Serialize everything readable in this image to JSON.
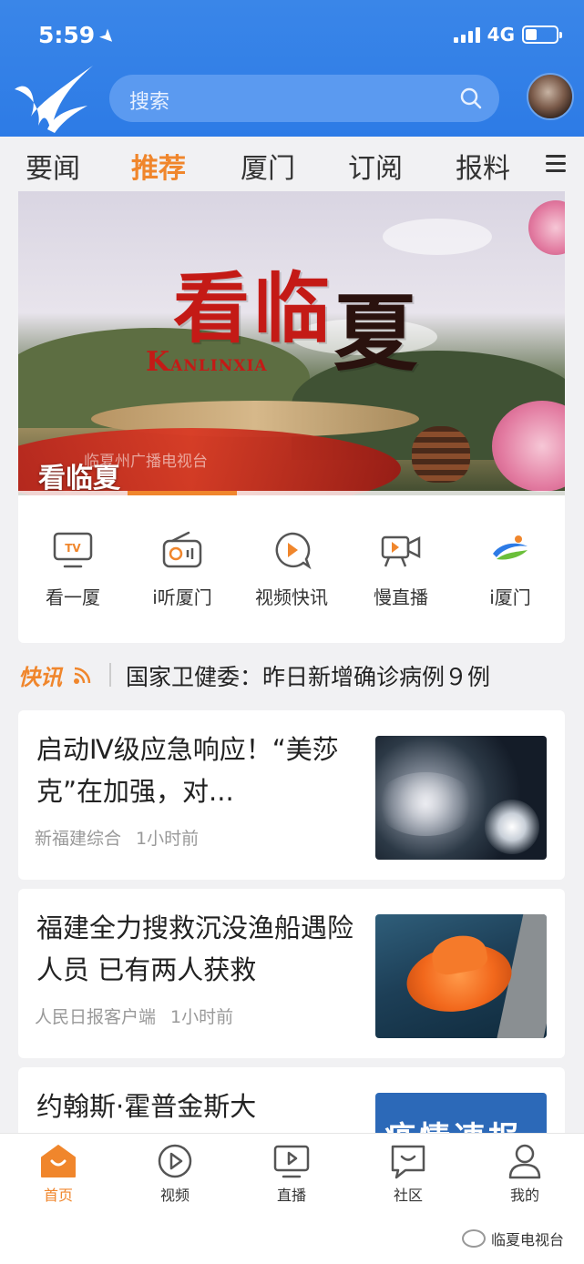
{
  "status": {
    "time": "5:59",
    "network": "4G"
  },
  "search": {
    "placeholder": "搜索"
  },
  "tabs": [
    {
      "label": "要闻",
      "active": false
    },
    {
      "label": "推荐",
      "active": true
    },
    {
      "label": "厦门",
      "active": false
    },
    {
      "label": "订阅",
      "active": false
    },
    {
      "label": "报料",
      "active": false
    }
  ],
  "banner": {
    "title_chars": [
      "看",
      "临",
      "夏"
    ],
    "pinyin_initial": "K",
    "pinyin_rest": "ANLINXIA",
    "watermark": "临夏州广播电视台",
    "caption": "看临夏",
    "progress_fraction": 0.2
  },
  "quick": [
    {
      "label": "看一厦",
      "icon": "tv-icon"
    },
    {
      "label": "i听厦门",
      "icon": "radio-icon"
    },
    {
      "label": "视频快讯",
      "icon": "play-bubble-icon"
    },
    {
      "label": "慢直播",
      "icon": "camera-icon"
    },
    {
      "label": "i厦门",
      "icon": "ixiamen-logo-icon"
    }
  ],
  "flash": {
    "tag": "快讯",
    "text": "国家卫健委：昨日新增确诊病例９例"
  },
  "news": [
    {
      "title": "启动Ⅳ级应急响应！“美莎克”在加强，对...",
      "source": "新福建综合",
      "time": "1小时前"
    },
    {
      "title": "福建全力搜救沉没渔船遇险人员 已有两人获救",
      "source": "人民日报客户端",
      "time": "1小时前"
    },
    {
      "title": "约翰斯·霍普金斯大",
      "thumb_text": "疫情速报"
    }
  ],
  "bottom_nav": [
    {
      "label": "首页",
      "active": true
    },
    {
      "label": "视频",
      "active": false
    },
    {
      "label": "直播",
      "active": false
    },
    {
      "label": "社区",
      "active": false
    },
    {
      "label": "我的",
      "active": false
    }
  ],
  "watermark": "临夏电视台",
  "colors": {
    "brand_blue": "#2d7be6",
    "accent_orange": "#f0862c"
  }
}
